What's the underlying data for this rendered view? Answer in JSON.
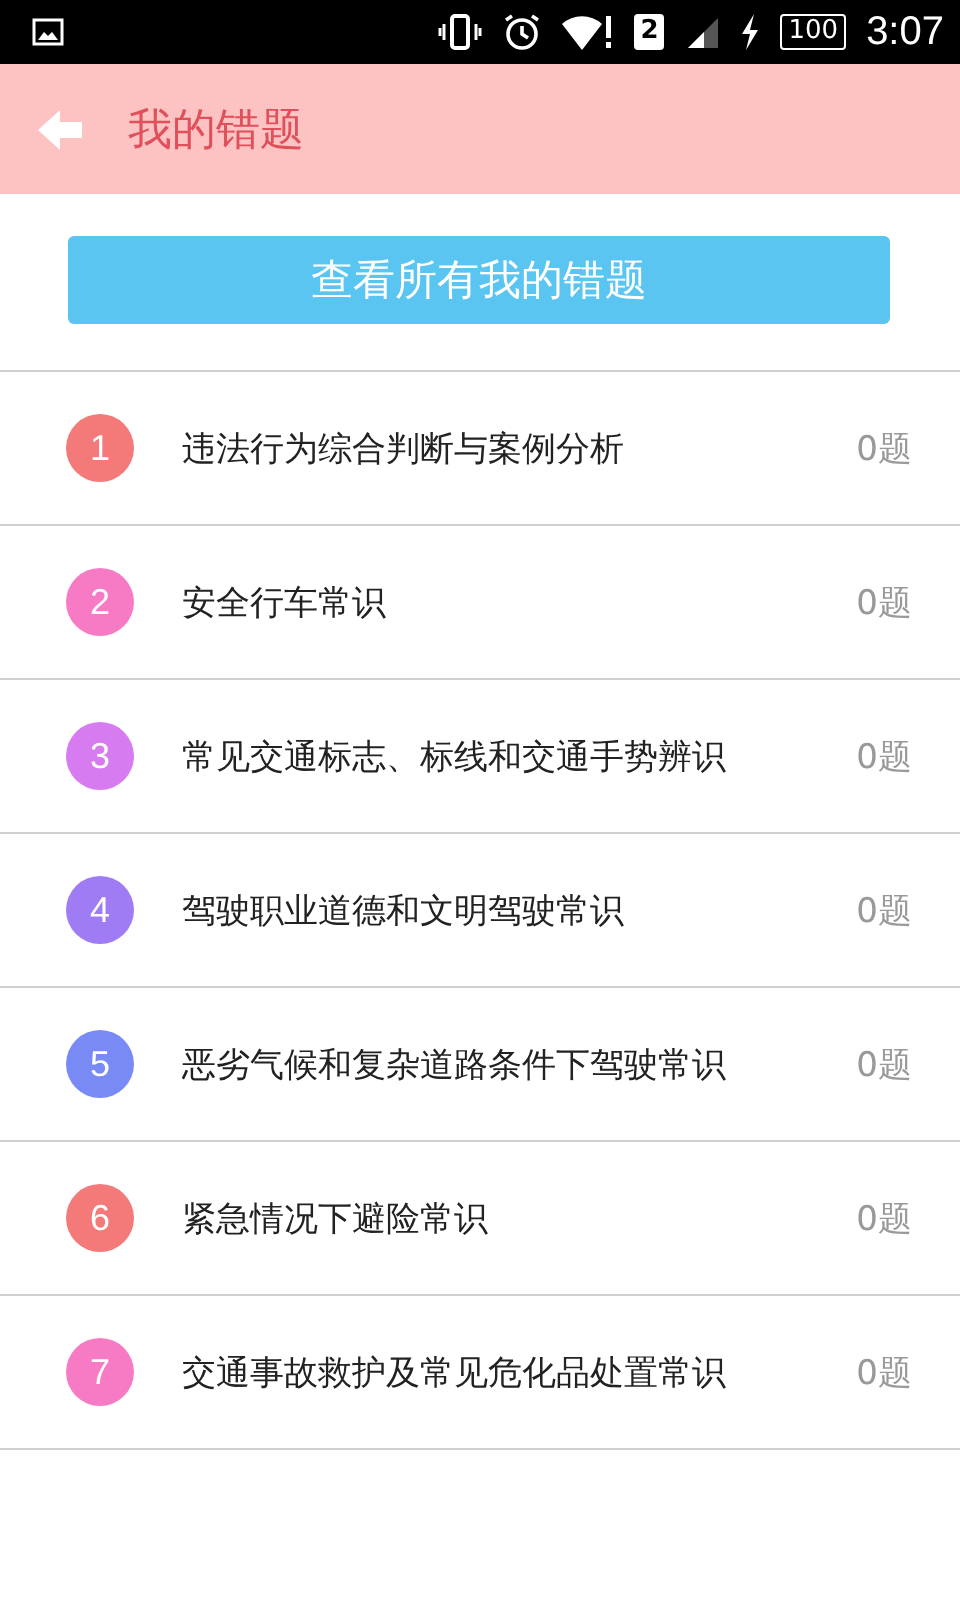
{
  "status_bar": {
    "sim": "2",
    "battery": "100",
    "time": "3:07"
  },
  "header": {
    "title": "我的错题"
  },
  "view_all_button": {
    "label": "查看所有我的错题"
  },
  "chapters": [
    {
      "number": "1",
      "title": "违法行为综合判断与案例分析",
      "count": "0题",
      "color": "#f47a7a"
    },
    {
      "number": "2",
      "title": "安全行车常识",
      "count": "0题",
      "color": "#f77bc4"
    },
    {
      "number": "3",
      "title": "常见交通标志、标线和交通手势辨识",
      "count": "0题",
      "color": "#d77cf0"
    },
    {
      "number": "4",
      "title": "驾驶职业道德和文明驾驶常识",
      "count": "0题",
      "color": "#9f7cf3"
    },
    {
      "number": "5",
      "title": "恶劣气候和复杂道路条件下驾驶常识",
      "count": "0题",
      "color": "#7a8af5"
    },
    {
      "number": "6",
      "title": "紧急情况下避险常识",
      "count": "0题",
      "color": "#f47a7a"
    },
    {
      "number": "7",
      "title": "交通事故救护及常见危化品处置常识",
      "count": "0题",
      "color": "#f77bc4"
    }
  ]
}
